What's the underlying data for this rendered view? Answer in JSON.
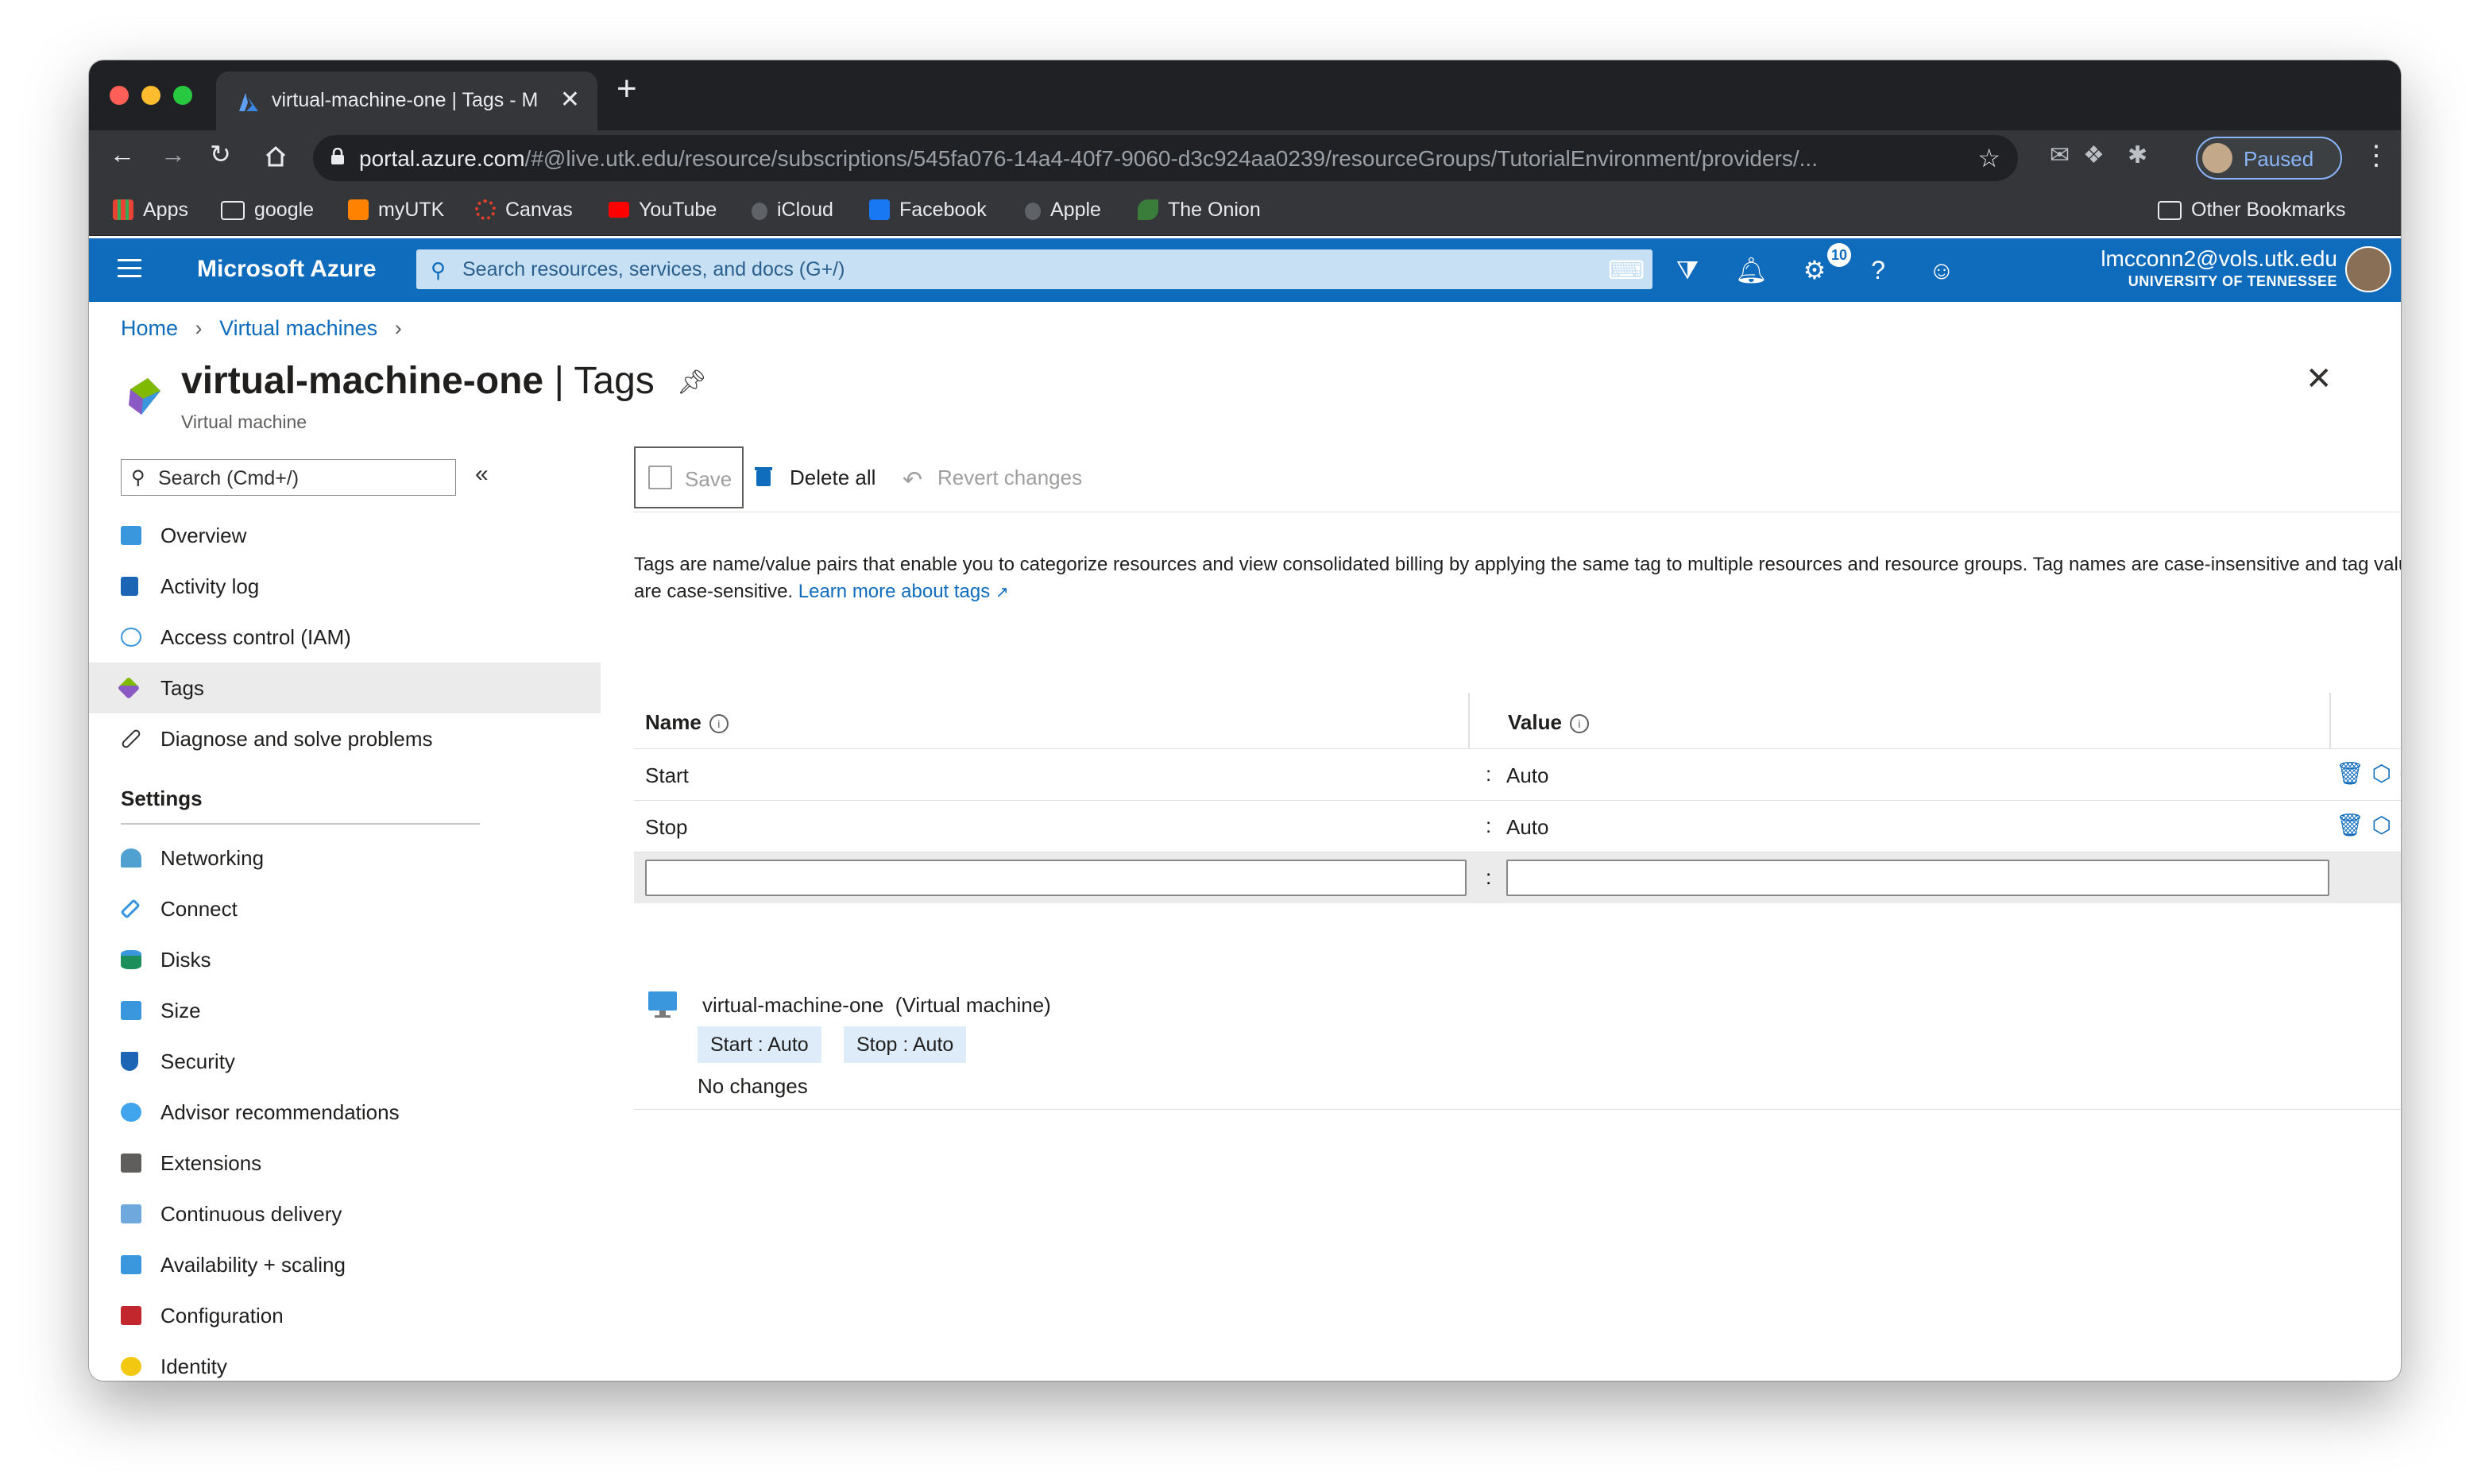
{
  "browser": {
    "tab_title": "virtual-machine-one | Tags - M",
    "url_host": "portal.azure.com",
    "url_rest": "/#@live.utk.edu/resource/subscriptions/545fa076-14a4-40f7-9060-d3c924aa0239/resourceGroups/TutorialEnvironment/providers/...",
    "profile_label": "Paused",
    "bookmarks": [
      "Apps",
      "google",
      "myUTK",
      "Canvas",
      "YouTube",
      "iCloud",
      "Facebook",
      "Apple",
      "The Onion"
    ],
    "other_bookmarks": "Other Bookmarks"
  },
  "azure": {
    "brand": "Microsoft Azure",
    "search_placeholder": "Search resources, services, and docs (G+/)",
    "notification_count": "10",
    "user_email": "lmcconn2@vols.utk.edu",
    "user_org": "UNIVERSITY OF TENNESSEE"
  },
  "breadcrumb": [
    "Home",
    "Virtual machines"
  ],
  "page": {
    "resource_name": "virtual-machine-one",
    "separator": "|",
    "section": "Tags",
    "subtitle": "Virtual machine"
  },
  "menu": {
    "search_placeholder": "Search (Cmd+/)",
    "items": [
      "Overview",
      "Activity log",
      "Access control (IAM)",
      "Tags",
      "Diagnose and solve problems"
    ],
    "settings_header": "Settings",
    "settings_items": [
      "Networking",
      "Connect",
      "Disks",
      "Size",
      "Security",
      "Advisor recommendations",
      "Extensions",
      "Continuous delivery",
      "Availability + scaling",
      "Configuration",
      "Identity"
    ]
  },
  "commands": {
    "save": "Save",
    "delete_all": "Delete all",
    "revert": "Revert changes"
  },
  "description": {
    "text": "Tags are name/value pairs that enable you to categorize resources and view consolidated billing by applying the same tag to multiple resources and resource groups. Tag names are case-insensitive and tag values are case-sensitive.",
    "link": "Learn more about tags"
  },
  "grid": {
    "name_header": "Name",
    "value_header": "Value",
    "rows": [
      {
        "name": "Start",
        "value": "Auto"
      },
      {
        "name": "Stop",
        "value": "Auto"
      }
    ],
    "separator": ":"
  },
  "summary": {
    "resource": "virtual-machine-one",
    "type": "(Virtual machine)",
    "pills": [
      "Start : Auto",
      "Stop : Auto"
    ],
    "status": "No changes"
  },
  "colors": {
    "azure_blue": "#0f6cbd",
    "chrome_dark": "#202124",
    "selected_bg": "#ebebeb"
  }
}
